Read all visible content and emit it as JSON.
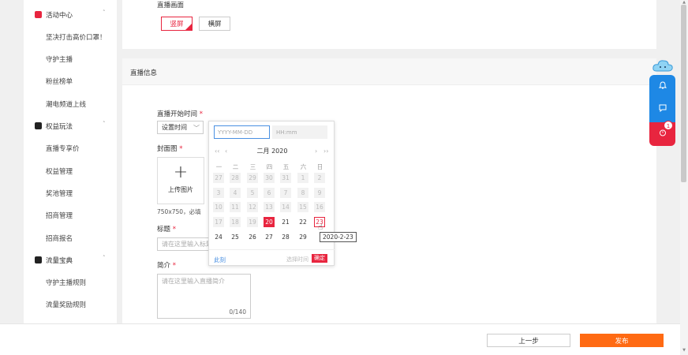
{
  "sidebar": {
    "groups": [
      {
        "label": "活动中心",
        "items": [
          "坚决打击高价口罩！",
          "守护主播",
          "粉丝榜单",
          "潮电频道上线"
        ]
      },
      {
        "label": "权益玩法",
        "items": [
          "直播专享价",
          "权益管理",
          "奖池管理",
          "招商管理",
          "招商报名"
        ]
      },
      {
        "label": "流量宝典",
        "items": [
          "守护主播规则",
          "流量奖励规则"
        ]
      }
    ]
  },
  "top_card": {
    "label": "直播画面",
    "portrait": "竖屏",
    "landscape": "横屏"
  },
  "section": {
    "title": "直播信息",
    "start_time_label": "直播开始时间",
    "required_mark": "*",
    "time_select": "设置时间",
    "cover_label": "封面图",
    "upload_label": "上传图片",
    "cover_hint": "750x750，必填",
    "title_label": "标题",
    "title_placeholder": "请在这里输入标题",
    "intro_label": "简介",
    "intro_placeholder": "请在这里输入直播简介",
    "intro_count": "0/140"
  },
  "datepicker": {
    "date_placeholder": "YYYY-MM-DD",
    "time_placeholder": "HH:mm",
    "month_title": "二月  2020",
    "prev_year": "‹‹",
    "prev_month": "‹",
    "next_month": "›",
    "next_year": "››",
    "weekdays": [
      "一",
      "二",
      "三",
      "四",
      "五",
      "六",
      "日"
    ],
    "rows": [
      [
        "27",
        "28",
        "29",
        "30",
        "31",
        "1",
        "2"
      ],
      [
        "3",
        "4",
        "5",
        "6",
        "7",
        "8",
        "9"
      ],
      [
        "10",
        "11",
        "12",
        "13",
        "14",
        "15",
        "16"
      ],
      [
        "17",
        "18",
        "19",
        "20",
        "21",
        "22",
        "23"
      ],
      [
        "24",
        "25",
        "26",
        "27",
        "28",
        "29",
        ""
      ]
    ],
    "today": "20",
    "hover_date": "23",
    "now_label": "此刻",
    "pick_time_label": "选择时间",
    "ok_label": "确定"
  },
  "tooltip": "2020-2-23",
  "float_bar": {
    "badge": "1"
  },
  "footer": {
    "prev_label": "上一步",
    "publish_label": "发布"
  },
  "colors": {
    "accent_red": "#e8253f",
    "primary_orange": "#ff6a13",
    "float_blue": "#1e88e5"
  }
}
